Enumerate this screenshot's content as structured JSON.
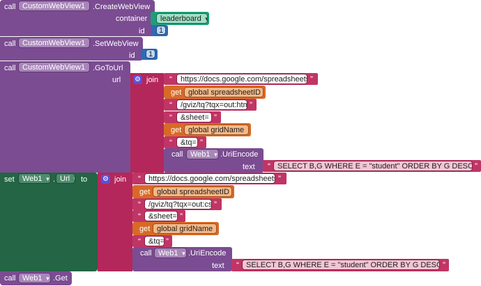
{
  "words": {
    "call": "call",
    "set": "set",
    "to": "to",
    "get": "get",
    "join": "join",
    "dot": "."
  },
  "blocks": {
    "create": {
      "component": "CustomWebView1",
      "method": ".CreateWebView",
      "container_label": "container",
      "container_value": "leaderboard",
      "id_label": "id",
      "id_value": "1"
    },
    "setwebview": {
      "component": "CustomWebView1",
      "method": ".SetWebView",
      "id_label": "id",
      "id_value": "1"
    },
    "gotourl": {
      "component": "CustomWebView1",
      "method": ".GoToUrl",
      "url_label": "url",
      "join_items": [
        {
          "kind": "text",
          "value": "https://docs.google.com/spreadsheets/d/"
        },
        {
          "kind": "var",
          "value": "global spreadsheetID"
        },
        {
          "kind": "text",
          "value": "/gviz/tq?tqx=out:html"
        },
        {
          "kind": "text",
          "value": "&sheet="
        },
        {
          "kind": "var",
          "value": "global gridName"
        },
        {
          "kind": "text",
          "value": "&tq="
        }
      ],
      "encode": {
        "component": "Web1",
        "method": ".UriEncode",
        "text_label": "text",
        "text_value": "SELECT B,G WHERE E = \"student\" ORDER BY G DESC L..."
      }
    },
    "seturl": {
      "component": "Web1",
      "property": "Url",
      "join_items": [
        {
          "kind": "text",
          "value": "https://docs.google.com/spreadsheets/d/"
        },
        {
          "kind": "var",
          "value": "global spreadsheetID"
        },
        {
          "kind": "text",
          "value": "/gviz/tq?tqx=out:csv"
        },
        {
          "kind": "text",
          "value": "&sheet="
        },
        {
          "kind": "var",
          "value": "global gridName"
        },
        {
          "kind": "text",
          "value": "&tq="
        }
      ],
      "encode": {
        "component": "Web1",
        "method": ".UriEncode",
        "text_label": "text",
        "text_value": "SELECT B,G WHERE E = \"student\" ORDER BY G DESC L..."
      }
    },
    "get": {
      "component": "Web1",
      "method": ".Get"
    }
  },
  "colors": {
    "procedure": "#7b4c92",
    "text": "#b4275a",
    "variable": "#d76a26",
    "setter": "#236544",
    "number": "#2f6ab3",
    "container": "#1f9e7a"
  }
}
